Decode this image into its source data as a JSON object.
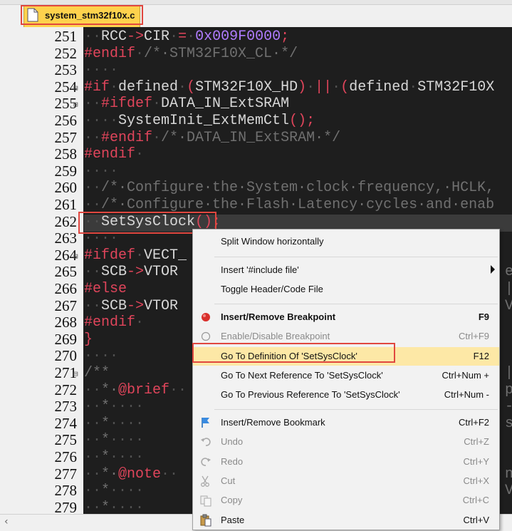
{
  "tab": {
    "filename": "system_stm32f10x.c"
  },
  "editor": {
    "lines": [
      {
        "n": "251",
        "fold": "",
        "html": [
          [
            "dots",
            "··"
          ],
          [
            "c-id",
            "RCC"
          ],
          [
            "c-op",
            "->"
          ],
          [
            "c-id",
            "CIR"
          ],
          [
            "dots",
            "·"
          ],
          [
            "c-op",
            "="
          ],
          [
            "dots",
            "·"
          ],
          [
            "c-num",
            "0x009F0000"
          ],
          [
            "c-op",
            ";"
          ]
        ]
      },
      {
        "n": "252",
        "fold": "",
        "html": [
          [
            "c-pre",
            "#endif"
          ],
          [
            "dots",
            "·"
          ],
          [
            "c-cm",
            "/*·STM32F10X_CL·*/"
          ]
        ]
      },
      {
        "n": "253",
        "fold": "",
        "html": [
          [
            "dots",
            "····"
          ]
        ]
      },
      {
        "n": "254",
        "fold": "⊟",
        "html": [
          [
            "c-pre",
            "#if"
          ],
          [
            "dots",
            "·"
          ],
          [
            "c-id",
            "defined"
          ],
          [
            "dots",
            "·"
          ],
          [
            "c-op",
            "("
          ],
          [
            "c-id",
            "STM32F10X_HD"
          ],
          [
            "c-op",
            ")"
          ],
          [
            "dots",
            "·"
          ],
          [
            "c-op",
            "||"
          ],
          [
            "dots",
            "·"
          ],
          [
            "c-op",
            "("
          ],
          [
            "c-id",
            "defined"
          ],
          [
            "dots",
            "·"
          ],
          [
            "c-id",
            "STM32F10X"
          ]
        ]
      },
      {
        "n": "255",
        "fold": "⊟",
        "html": [
          [
            "dots",
            "··"
          ],
          [
            "c-pre",
            "#ifdef"
          ],
          [
            "dots",
            "·"
          ],
          [
            "c-id",
            "DATA_IN_ExtSRAM"
          ]
        ]
      },
      {
        "n": "256",
        "fold": "",
        "html": [
          [
            "dots",
            "····"
          ],
          [
            "c-id",
            "SystemInit_ExtMemCtl"
          ],
          [
            "c-op",
            "();"
          ]
        ]
      },
      {
        "n": "257",
        "fold": "",
        "html": [
          [
            "dots",
            "··"
          ],
          [
            "c-pre",
            "#endif"
          ],
          [
            "dots",
            "·"
          ],
          [
            "c-cm",
            "/*·DATA_IN_ExtSRAM·*/"
          ]
        ]
      },
      {
        "n": "258",
        "fold": "",
        "html": [
          [
            "c-pre",
            "#endif"
          ],
          [
            "dots",
            "·"
          ]
        ]
      },
      {
        "n": "259",
        "fold": "",
        "html": [
          [
            "dots",
            "····"
          ]
        ]
      },
      {
        "n": "260",
        "fold": "",
        "html": [
          [
            "dots",
            "··"
          ],
          [
            "c-cm",
            "/*·Configure·the·System·clock·frequency,·HCLK,"
          ]
        ]
      },
      {
        "n": "261",
        "fold": "",
        "html": [
          [
            "dots",
            "··"
          ],
          [
            "c-cm",
            "/*·Configure·the·Flash·Latency·cycles·and·enab"
          ]
        ]
      },
      {
        "n": "262",
        "fold": "",
        "html": [
          [
            "dots",
            "··"
          ],
          [
            "c-id",
            "SetSysClock"
          ],
          [
            "c-op",
            "();"
          ]
        ]
      },
      {
        "n": "263",
        "fold": "",
        "html": [
          [
            "dots",
            "····"
          ]
        ]
      },
      {
        "n": "264",
        "fold": "⊟",
        "html": [
          [
            "c-pre",
            "#ifdef"
          ],
          [
            "dots",
            "·"
          ],
          [
            "c-id",
            "VECT_"
          ]
        ]
      },
      {
        "n": "265",
        "fold": "",
        "html": [
          [
            "dots",
            "··"
          ],
          [
            "c-id",
            "SCB"
          ],
          [
            "c-op",
            "->"
          ],
          [
            "c-id",
            "VTOR"
          ]
        ]
      },
      {
        "n": "266",
        "fold": "",
        "html": [
          [
            "c-pre",
            "#else"
          ]
        ]
      },
      {
        "n": "267",
        "fold": "",
        "html": [
          [
            "dots",
            "··"
          ],
          [
            "c-id",
            "SCB"
          ],
          [
            "c-op",
            "->"
          ],
          [
            "c-id",
            "VTOR"
          ]
        ]
      },
      {
        "n": "268",
        "fold": "",
        "html": [
          [
            "c-pre",
            "#endif"
          ],
          [
            "dots",
            "·"
          ]
        ]
      },
      {
        "n": "269",
        "fold": "",
        "html": [
          [
            "c-op",
            "}"
          ]
        ]
      },
      {
        "n": "270",
        "fold": "",
        "html": [
          [
            "dots",
            "····"
          ]
        ]
      },
      {
        "n": "271",
        "fold": "⊟",
        "html": [
          [
            "c-cm",
            "/**"
          ]
        ]
      },
      {
        "n": "272",
        "fold": "",
        "html": [
          [
            "dots",
            "··"
          ],
          [
            "c-cm",
            "*·"
          ],
          [
            "c-kw",
            "@brief"
          ],
          [
            "dots",
            "··"
          ]
        ]
      },
      {
        "n": "273",
        "fold": "",
        "html": [
          [
            "dots",
            "··"
          ],
          [
            "c-cm",
            "*"
          ],
          [
            "dots",
            "····"
          ]
        ]
      },
      {
        "n": "274",
        "fold": "",
        "html": [
          [
            "dots",
            "··"
          ],
          [
            "c-cm",
            "*"
          ],
          [
            "dots",
            "····"
          ]
        ]
      },
      {
        "n": "275",
        "fold": "",
        "html": [
          [
            "dots",
            "··"
          ],
          [
            "c-cm",
            "*"
          ],
          [
            "dots",
            "····"
          ]
        ]
      },
      {
        "n": "276",
        "fold": "",
        "html": [
          [
            "dots",
            "··"
          ],
          [
            "c-cm",
            "*"
          ],
          [
            "dots",
            "····"
          ]
        ]
      },
      {
        "n": "277",
        "fold": "",
        "html": [
          [
            "dots",
            "··"
          ],
          [
            "c-cm",
            "*·"
          ],
          [
            "c-kw",
            "@note"
          ],
          [
            "dots",
            "··"
          ]
        ]
      },
      {
        "n": "278",
        "fold": "",
        "html": [
          [
            "dots",
            "··"
          ],
          [
            "c-cm",
            "*"
          ],
          [
            "dots",
            "····"
          ]
        ]
      },
      {
        "n": "279",
        "fold": "",
        "html": [
          [
            "dots",
            "··"
          ],
          [
            "c-cm",
            "*"
          ],
          [
            "dots",
            "····"
          ]
        ]
      }
    ],
    "right_fragments": [
      {
        "line": "265",
        "text": "e"
      },
      {
        "line": "266",
        "text": "|"
      },
      {
        "line": "267",
        "text": "V"
      },
      {
        "line": "271",
        "text": "|"
      },
      {
        "line": "272",
        "text": "p"
      },
      {
        "line": "273",
        "text": "-"
      },
      {
        "line": "274",
        "text": "s"
      },
      {
        "line": "277",
        "text": "n"
      },
      {
        "line": "278",
        "text": "V"
      }
    ]
  },
  "context_menu": {
    "items": [
      {
        "type": "item",
        "label": "Split Window horizontally",
        "shortcut": "",
        "icon": "",
        "bold": false,
        "disabled": false,
        "submenu": false
      },
      {
        "type": "sep"
      },
      {
        "type": "item",
        "label": "Insert '#include file'",
        "shortcut": "",
        "icon": "",
        "bold": false,
        "disabled": false,
        "submenu": true
      },
      {
        "type": "item",
        "label": "Toggle Header/Code File",
        "shortcut": "",
        "icon": "",
        "bold": false,
        "disabled": false,
        "submenu": false
      },
      {
        "type": "sep"
      },
      {
        "type": "item",
        "label": "Insert/Remove Breakpoint",
        "shortcut": "F9",
        "icon": "breakpoint-icon",
        "bold": true,
        "disabled": false,
        "submenu": false
      },
      {
        "type": "item",
        "label": "Enable/Disable Breakpoint",
        "shortcut": "Ctrl+F9",
        "icon": "disabled-breakpoint-icon",
        "bold": false,
        "disabled": true,
        "submenu": false
      },
      {
        "type": "item",
        "label": "Go To Definition Of 'SetSysClock'",
        "shortcut": "F12",
        "icon": "",
        "bold": false,
        "disabled": false,
        "submenu": false,
        "selected": true
      },
      {
        "type": "item",
        "label": "Go To Next Reference To 'SetSysClock'",
        "shortcut": "Ctrl+Num +",
        "icon": "",
        "bold": false,
        "disabled": false,
        "submenu": false
      },
      {
        "type": "item",
        "label": "Go To Previous Reference To 'SetSysClock'",
        "shortcut": "Ctrl+Num -",
        "icon": "",
        "bold": false,
        "disabled": false,
        "submenu": false
      },
      {
        "type": "sep"
      },
      {
        "type": "item",
        "label": "Insert/Remove Bookmark",
        "shortcut": "Ctrl+F2",
        "icon": "bookmark-flag-icon",
        "bold": false,
        "disabled": false,
        "submenu": false
      },
      {
        "type": "item",
        "label": "Undo",
        "shortcut": "Ctrl+Z",
        "icon": "undo-icon",
        "bold": false,
        "disabled": true,
        "submenu": false
      },
      {
        "type": "item",
        "label": "Redo",
        "shortcut": "Ctrl+Y",
        "icon": "redo-icon",
        "bold": false,
        "disabled": true,
        "submenu": false
      },
      {
        "type": "item",
        "label": "Cut",
        "shortcut": "Ctrl+X",
        "icon": "cut-icon",
        "bold": false,
        "disabled": true,
        "submenu": false
      },
      {
        "type": "item",
        "label": "Copy",
        "shortcut": "Ctrl+C",
        "icon": "copy-icon",
        "bold": false,
        "disabled": true,
        "submenu": false
      },
      {
        "type": "item",
        "label": "Paste",
        "shortcut": "Ctrl+V",
        "icon": "paste-icon",
        "bold": false,
        "disabled": false,
        "submenu": false
      }
    ]
  },
  "colors": {
    "tab_active": "#ffd24d",
    "editor_bg": "#1e1e1e",
    "keyword": "#e0455b",
    "comment": "#707070",
    "number": "#b07cff",
    "menu_selected": "#fde8a6",
    "annotation_box": "#e0473f"
  }
}
